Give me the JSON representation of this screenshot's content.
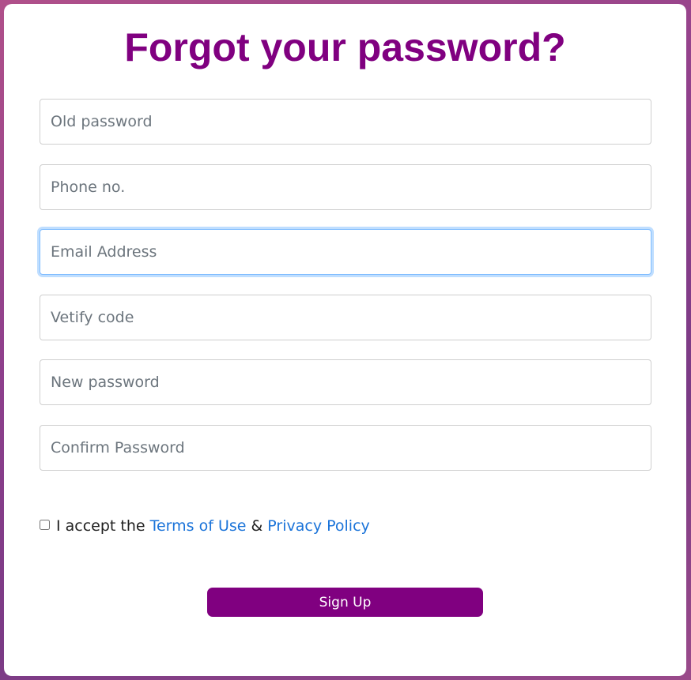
{
  "header": {
    "title": "Forgot your password?"
  },
  "form": {
    "fields": [
      {
        "placeholder": "Old password",
        "value": ""
      },
      {
        "placeholder": "Phone no.",
        "value": ""
      },
      {
        "placeholder": "Email Address",
        "value": "",
        "focused": true
      },
      {
        "placeholder": "Vetify code",
        "value": ""
      },
      {
        "placeholder": "New password",
        "value": ""
      },
      {
        "placeholder": "Confirm Password",
        "value": ""
      }
    ],
    "terms": {
      "checked": false,
      "prefix": "I accept the",
      "terms_link": "Terms of Use",
      "separator": "&",
      "privacy_link": "Privacy Policy"
    },
    "submit_label": "Sign Up"
  },
  "colors": {
    "accent": "#800080",
    "link": "#1a73d9",
    "focus_border": "#80bdff",
    "background_gradient": [
      "#b0508a",
      "#7a3a85"
    ]
  }
}
